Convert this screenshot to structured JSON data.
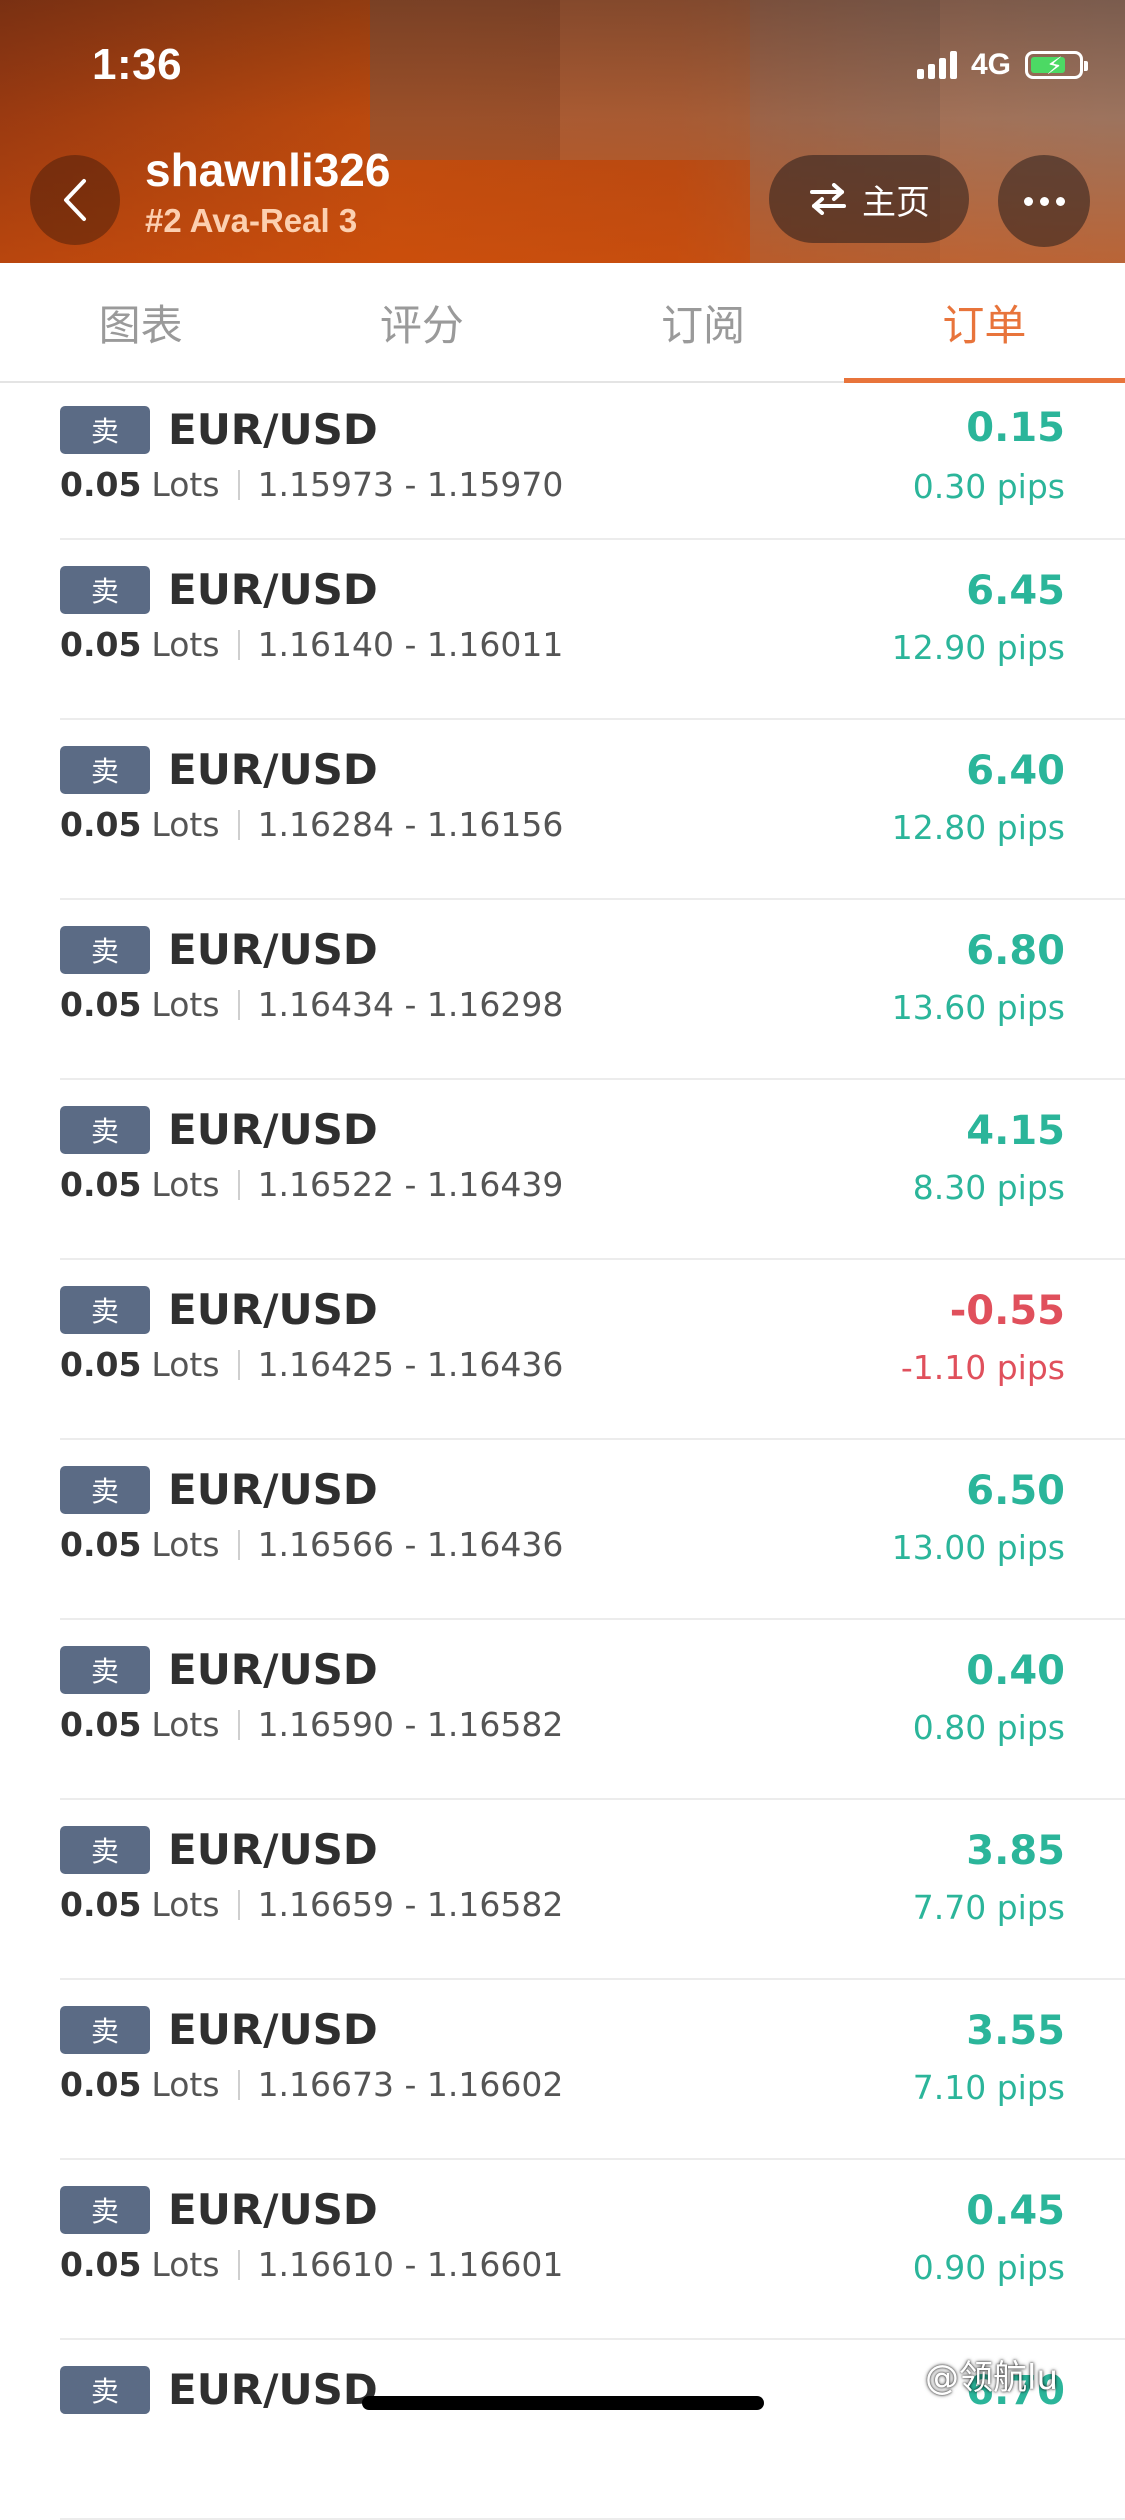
{
  "status_bar": {
    "time": "1:36",
    "network": "4G"
  },
  "header": {
    "username": "shawnli326",
    "account": "#2 Ava-Real 3",
    "home_label": "主页"
  },
  "tabs": [
    {
      "label": "图表",
      "active": false
    },
    {
      "label": "评分",
      "active": false
    },
    {
      "label": "订阅",
      "active": false
    },
    {
      "label": "订单",
      "active": true
    }
  ],
  "orders": [
    {
      "side": "卖",
      "symbol": "EUR/USD",
      "lots": "0.05",
      "lots_unit": "Lots",
      "prices": "1.15973 - 1.15970",
      "profit": "0.15",
      "pips": "0.30 pips",
      "positive": true
    },
    {
      "side": "卖",
      "symbol": "EUR/USD",
      "lots": "0.05",
      "lots_unit": "Lots",
      "prices": "1.16140 - 1.16011",
      "profit": "6.45",
      "pips": "12.90 pips",
      "positive": true
    },
    {
      "side": "卖",
      "symbol": "EUR/USD",
      "lots": "0.05",
      "lots_unit": "Lots",
      "prices": "1.16284 - 1.16156",
      "profit": "6.40",
      "pips": "12.80 pips",
      "positive": true
    },
    {
      "side": "卖",
      "symbol": "EUR/USD",
      "lots": "0.05",
      "lots_unit": "Lots",
      "prices": "1.16434 - 1.16298",
      "profit": "6.80",
      "pips": "13.60 pips",
      "positive": true
    },
    {
      "side": "卖",
      "symbol": "EUR/USD",
      "lots": "0.05",
      "lots_unit": "Lots",
      "prices": "1.16522 - 1.16439",
      "profit": "4.15",
      "pips": "8.30 pips",
      "positive": true
    },
    {
      "side": "卖",
      "symbol": "EUR/USD",
      "lots": "0.05",
      "lots_unit": "Lots",
      "prices": "1.16425 - 1.16436",
      "profit": "-0.55",
      "pips": "-1.10 pips",
      "positive": false
    },
    {
      "side": "卖",
      "symbol": "EUR/USD",
      "lots": "0.05",
      "lots_unit": "Lots",
      "prices": "1.16566 - 1.16436",
      "profit": "6.50",
      "pips": "13.00 pips",
      "positive": true
    },
    {
      "side": "卖",
      "symbol": "EUR/USD",
      "lots": "0.05",
      "lots_unit": "Lots",
      "prices": "1.16590 - 1.16582",
      "profit": "0.40",
      "pips": "0.80 pips",
      "positive": true
    },
    {
      "side": "卖",
      "symbol": "EUR/USD",
      "lots": "0.05",
      "lots_unit": "Lots",
      "prices": "1.16659 - 1.16582",
      "profit": "3.85",
      "pips": "7.70 pips",
      "positive": true
    },
    {
      "side": "卖",
      "symbol": "EUR/USD",
      "lots": "0.05",
      "lots_unit": "Lots",
      "prices": "1.16673 - 1.16602",
      "profit": "3.55",
      "pips": "7.10 pips",
      "positive": true
    },
    {
      "side": "卖",
      "symbol": "EUR/USD",
      "lots": "0.05",
      "lots_unit": "Lots",
      "prices": "1.16610 - 1.16601",
      "profit": "0.45",
      "pips": "0.90 pips",
      "positive": true
    },
    {
      "side": "卖",
      "symbol": "EUR/USD",
      "lots": "",
      "lots_unit": "",
      "prices": "",
      "profit": "6.70",
      "pips": "",
      "positive": true
    }
  ],
  "watermark": "@领航lu",
  "colors": {
    "accent": "#e8743b",
    "profit_positive": "#2bb59a",
    "profit_negative": "#e0505c",
    "badge_bg": "#5b6b85"
  }
}
